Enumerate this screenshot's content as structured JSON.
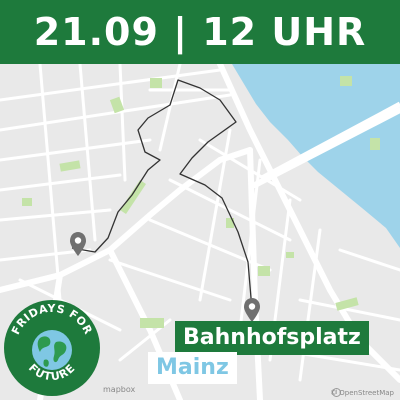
{
  "header": {
    "title": "21.09 | 12 UHR"
  },
  "map": {
    "start_marker": "map-pin-icon",
    "end_marker": "map-pin-icon",
    "destination_label": "Bahnhofsplatz",
    "city_label": "Mainz"
  },
  "logo": {
    "text": "FRIDAYS FOR FUTURE",
    "icon": "earth-globe-icon"
  },
  "footer": {
    "mapbox_logo": "mapbox",
    "info_icon": "info-icon",
    "attribution": "© OpenStreetMap"
  },
  "colors": {
    "banner": "#1e7a3c",
    "river": "#7fc7e4",
    "city_text": "#7fc7e4",
    "map_background": "#e9e9e9",
    "roads": "#ffffff",
    "parks": "#c4e3a8",
    "route": "#333333",
    "marker": "#707070"
  }
}
